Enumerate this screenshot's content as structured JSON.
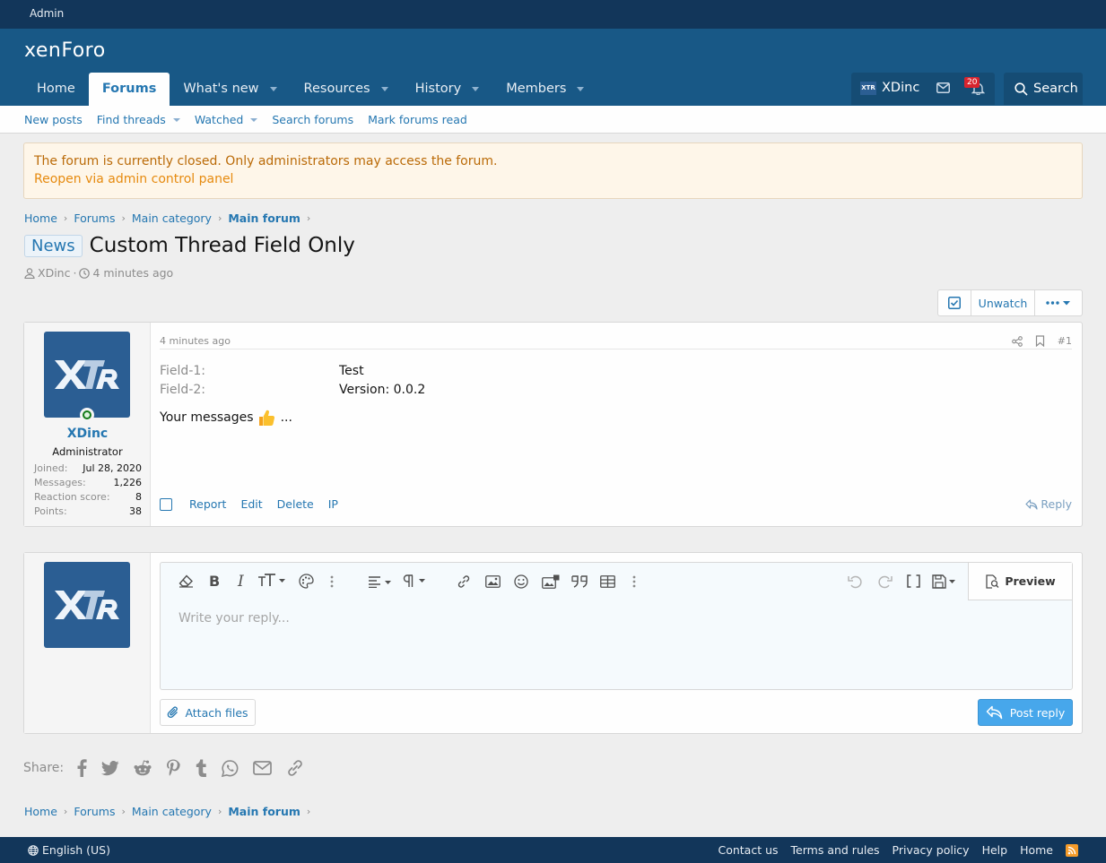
{
  "admin_bar": {
    "label": "Admin"
  },
  "header": {
    "logo": "xenForo",
    "nav": [
      {
        "label": "Home",
        "active": false,
        "dropdown": false
      },
      {
        "label": "Forums",
        "active": true,
        "dropdown": false
      },
      {
        "label": "What's new",
        "active": false,
        "dropdown": true
      },
      {
        "label": "Resources",
        "active": false,
        "dropdown": true
      },
      {
        "label": "History",
        "active": false,
        "dropdown": true
      },
      {
        "label": "Members",
        "active": false,
        "dropdown": true
      }
    ],
    "user": {
      "name": "XDinc",
      "avatar_text": "XTR"
    },
    "alert_count": "20",
    "search_label": "Search"
  },
  "subnav": {
    "items": [
      "New posts",
      "Find threads",
      "Watched",
      "Search forums",
      "Mark forums read"
    ]
  },
  "notice": {
    "text": "The forum is currently closed. Only administrators may access the forum.",
    "link": "Reopen via admin control panel"
  },
  "breadcrumb": [
    "Home",
    "Forums",
    "Main category",
    "Main forum"
  ],
  "thread": {
    "prefix": "News",
    "title": "Custom Thread Field Only",
    "author": "XDinc",
    "meta_sep": "·",
    "time": "4 minutes ago",
    "unwatch_label": "Unwatch"
  },
  "post": {
    "time": "4 minutes ago",
    "number": "#1",
    "user": {
      "name": "XDinc",
      "title": "Administrator",
      "avatar_text": "XTR",
      "stats": [
        {
          "k": "Joined:",
          "v": "Jul 28, 2020"
        },
        {
          "k": "Messages:",
          "v": "1,226"
        },
        {
          "k": "Reaction score:",
          "v": "8"
        },
        {
          "k": "Points:",
          "v": "38"
        }
      ]
    },
    "fields": [
      {
        "k": "Field-1:",
        "v": "Test"
      },
      {
        "k": "Field-2:",
        "v": "Version: 0.0.2"
      }
    ],
    "body": "Your messages",
    "body_tail": "...",
    "actions": [
      "Report",
      "Edit",
      "Delete",
      "IP"
    ],
    "reply_label": "Reply"
  },
  "reply_form": {
    "placeholder": "Write your reply...",
    "preview_label": "Preview",
    "attach_label": "Attach files",
    "post_label": "Post reply"
  },
  "share": {
    "label": "Share:"
  },
  "footer": {
    "language": "English (US)",
    "links": [
      "Contact us",
      "Terms and rules",
      "Privacy policy",
      "Help",
      "Home"
    ]
  }
}
